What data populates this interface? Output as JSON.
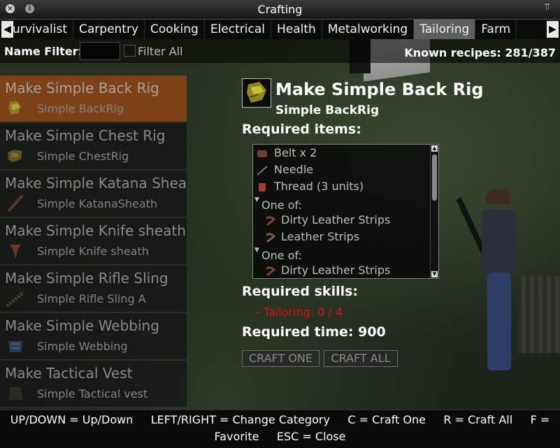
{
  "window": {
    "title": "Crafting"
  },
  "tabs": [
    {
      "label": "urvivalist"
    },
    {
      "label": "Carpentry"
    },
    {
      "label": "Cooking"
    },
    {
      "label": "Electrical"
    },
    {
      "label": "Health"
    },
    {
      "label": "Metalworking"
    },
    {
      "label": "Tailoring"
    },
    {
      "label": "Farm"
    }
  ],
  "filter": {
    "label": "Name Filter:",
    "value": "",
    "filter_all_label": "Filter All",
    "filter_all_checked": false
  },
  "known_recipes": "Known recipes:  281/387",
  "recipes": [
    {
      "name": "Make Simple Back Rig",
      "result": "Simple BackRig",
      "icon": "backrig-icon"
    },
    {
      "name": "Make Simple Chest Rig",
      "result": "Simple ChestRig",
      "icon": "chestrig-icon"
    },
    {
      "name": "Make Simple Katana Sheath",
      "result": "Simple KatanaSheath",
      "icon": "katana-sheath-icon"
    },
    {
      "name": "Make Simple Knife sheath",
      "result": "Simple Knife sheath",
      "icon": "knife-sheath-icon"
    },
    {
      "name": "Make Simple Rifle Sling",
      "result": "Simple Rifle Sling A",
      "icon": "rifle-sling-icon"
    },
    {
      "name": "Make Simple Webbing",
      "result": "Simple Webbing",
      "icon": "webbing-icon"
    },
    {
      "name": "Make Tactical Vest",
      "result": "Simple Tactical vest",
      "icon": "tactical-vest-icon"
    }
  ],
  "detail": {
    "title": "Make Simple Back Rig",
    "result": "Simple BackRig",
    "required_items_label": "Required items:",
    "items": [
      {
        "text": "Belt x 2",
        "icon": "belt-icon"
      },
      {
        "text": "Needle",
        "icon": "needle-icon"
      },
      {
        "text": "Thread (3 units)",
        "icon": "thread-icon"
      },
      {
        "text": "One of:",
        "icon": "triangle-down-icon"
      },
      {
        "text": "Dirty Leather Strips",
        "icon": "leather-strips-icon"
      },
      {
        "text": "Leather Strips",
        "icon": "leather-strips-icon"
      },
      {
        "text": "One of:",
        "icon": "triangle-down-icon"
      },
      {
        "text": "Dirty Leather Strips",
        "icon": "leather-strips-icon"
      }
    ],
    "required_skills_label": "Required skills:",
    "skill_line": "- Tailoring: 0 / 4",
    "required_time": "Required time: 900",
    "craft_one_label": "CRAFT ONE",
    "craft_all_label": "CRAFT ALL"
  },
  "footer": {
    "line1": "UP/DOWN = Up/Down     LEFT/RIGHT = Change Category     C = Craft One     R = Craft All     F =",
    "line2": "Favorite     ESC = Close"
  },
  "colors": {
    "selected_row": "#96461e",
    "skill_missing": "#e01010",
    "active_tab": "#5e5e5e"
  }
}
